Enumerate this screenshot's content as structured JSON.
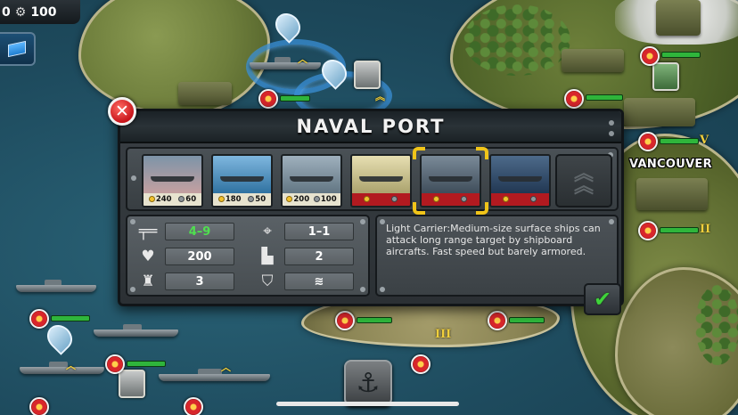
{
  "resources": {
    "icon_1": "flag-icon",
    "value_1": "0",
    "icon_2": "gear-icon",
    "value_2": "100"
  },
  "map": {
    "city_label": "VANCOUVER",
    "rank_1": "V",
    "rank_2": "II",
    "rank_3": "III"
  },
  "dialog": {
    "title": "NAVAL PORT",
    "units": [
      {
        "name": "destroyer",
        "coin": "240",
        "gear": "60",
        "locked": false,
        "colors": [
          "#7d94a8",
          "#c7a0a0"
        ]
      },
      {
        "name": "submarine",
        "coin": "180",
        "gear": "50",
        "locked": false,
        "colors": [
          "#7fb7df",
          "#2c6f9e"
        ]
      },
      {
        "name": "battleship",
        "coin": "200",
        "gear": "100",
        "locked": false,
        "colors": [
          "#9fb0bd",
          "#5f7380"
        ]
      },
      {
        "name": "cruiser",
        "coin": "",
        "gear": "",
        "locked": true,
        "colors": [
          "#e7dfb2",
          "#a8a06a"
        ]
      },
      {
        "name": "light-carrier",
        "coin": "",
        "gear": "",
        "locked": true,
        "colors": [
          "#7a8a98",
          "#3c4a57"
        ]
      },
      {
        "name": "aircraft-carrier",
        "coin": "",
        "gear": "",
        "locked": true,
        "colors": [
          "#4d6a8a",
          "#1f3550"
        ]
      }
    ],
    "stats": {
      "attack": "4–9",
      "range": "1–1",
      "hp": "200",
      "move": "2",
      "defense": "3",
      "armor": ""
    },
    "description": "Light Carrier:Medium-size surface ships can attack long range target by shipboard aircrafts. Fast speed but barely armored.",
    "confirm_icon": "checkmark-icon",
    "close_icon": "close-icon"
  },
  "colors": {
    "accent_gold": "#f0c419",
    "hp_green": "#2fb53b",
    "lock_red": "#b21a20",
    "confirm_green": "#3fd33a"
  }
}
